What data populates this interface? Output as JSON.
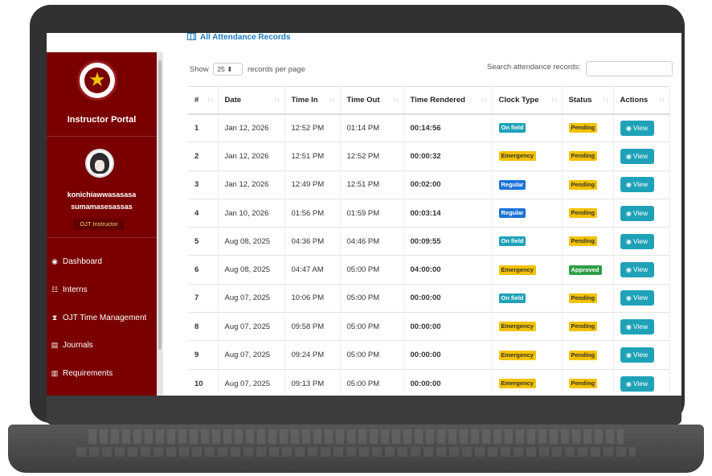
{
  "header": {
    "title": "All Attendance Records",
    "icon": "table-icon"
  },
  "sidebar": {
    "portal_title": "Instructor Portal",
    "user_name_line1": "konichiawwasasasa",
    "user_name_line2": "sumamasesassas",
    "role": "OJT Instructor",
    "items": [
      {
        "label": "Dashboard",
        "icon": "dashboard-icon",
        "glyph": "◉"
      },
      {
        "label": "Interns",
        "icon": "users-icon",
        "glyph": "☷"
      },
      {
        "label": "OJT Time Management",
        "icon": "hourglass-icon",
        "glyph": "⧗"
      },
      {
        "label": "Journals",
        "icon": "book-icon",
        "glyph": "▤"
      },
      {
        "label": "Requirements",
        "icon": "file-icon",
        "glyph": "▥"
      }
    ]
  },
  "controls": {
    "show_label": "Show",
    "per_page_value": "25",
    "per_page_suffix": "records per page",
    "search_label": "Search attendance records:"
  },
  "table": {
    "columns": [
      "#",
      "Date",
      "Time In",
      "Time Out",
      "Time Rendered",
      "Clock Type",
      "Status",
      "Actions"
    ],
    "view_label": "View",
    "rows": [
      {
        "n": "1",
        "date": "Jan 12, 2026",
        "in": "12:52 PM",
        "out": "01:14 PM",
        "rendered": "00:14:56",
        "clock": "On field",
        "status": "Pending"
      },
      {
        "n": "2",
        "date": "Jan 12, 2026",
        "in": "12:51 PM",
        "out": "12:52 PM",
        "rendered": "00:00:32",
        "clock": "Emergency",
        "status": "Pending"
      },
      {
        "n": "3",
        "date": "Jan 12, 2026",
        "in": "12:49 PM",
        "out": "12:51 PM",
        "rendered": "00:02:00",
        "clock": "Regular",
        "status": "Pending"
      },
      {
        "n": "4",
        "date": "Jan 10, 2026",
        "in": "01:56 PM",
        "out": "01:59 PM",
        "rendered": "00:03:14",
        "clock": "Regular",
        "status": "Pending"
      },
      {
        "n": "5",
        "date": "Aug 08, 2025",
        "in": "04:36 PM",
        "out": "04:46 PM",
        "rendered": "00:09:55",
        "clock": "On field",
        "status": "Pending"
      },
      {
        "n": "6",
        "date": "Aug 08, 2025",
        "in": "04:47 AM",
        "out": "05:00 PM",
        "rendered": "04:00:00",
        "clock": "Emergency",
        "status": "Approved"
      },
      {
        "n": "7",
        "date": "Aug 07, 2025",
        "in": "10:06 PM",
        "out": "05:00 PM",
        "rendered": "00:00:00",
        "clock": "On field",
        "status": "Pending"
      },
      {
        "n": "8",
        "date": "Aug 07, 2025",
        "in": "09:58 PM",
        "out": "05:00 PM",
        "rendered": "00:00:00",
        "clock": "Emergency",
        "status": "Pending"
      },
      {
        "n": "9",
        "date": "Aug 07, 2025",
        "in": "09:24 PM",
        "out": "05:00 PM",
        "rendered": "00:00:00",
        "clock": "Emergency",
        "status": "Pending"
      },
      {
        "n": "10",
        "date": "Aug 07, 2025",
        "in": "09:13 PM",
        "out": "05:00 PM",
        "rendered": "00:00:00",
        "clock": "Emergency",
        "status": "Pending"
      }
    ]
  },
  "colors": {
    "sidebar": "#7a0000",
    "accent": "#1f7ac4",
    "info": "#1fa2b8",
    "warning": "#f2c200",
    "primary": "#1c73d6",
    "success": "#2e9d46"
  }
}
